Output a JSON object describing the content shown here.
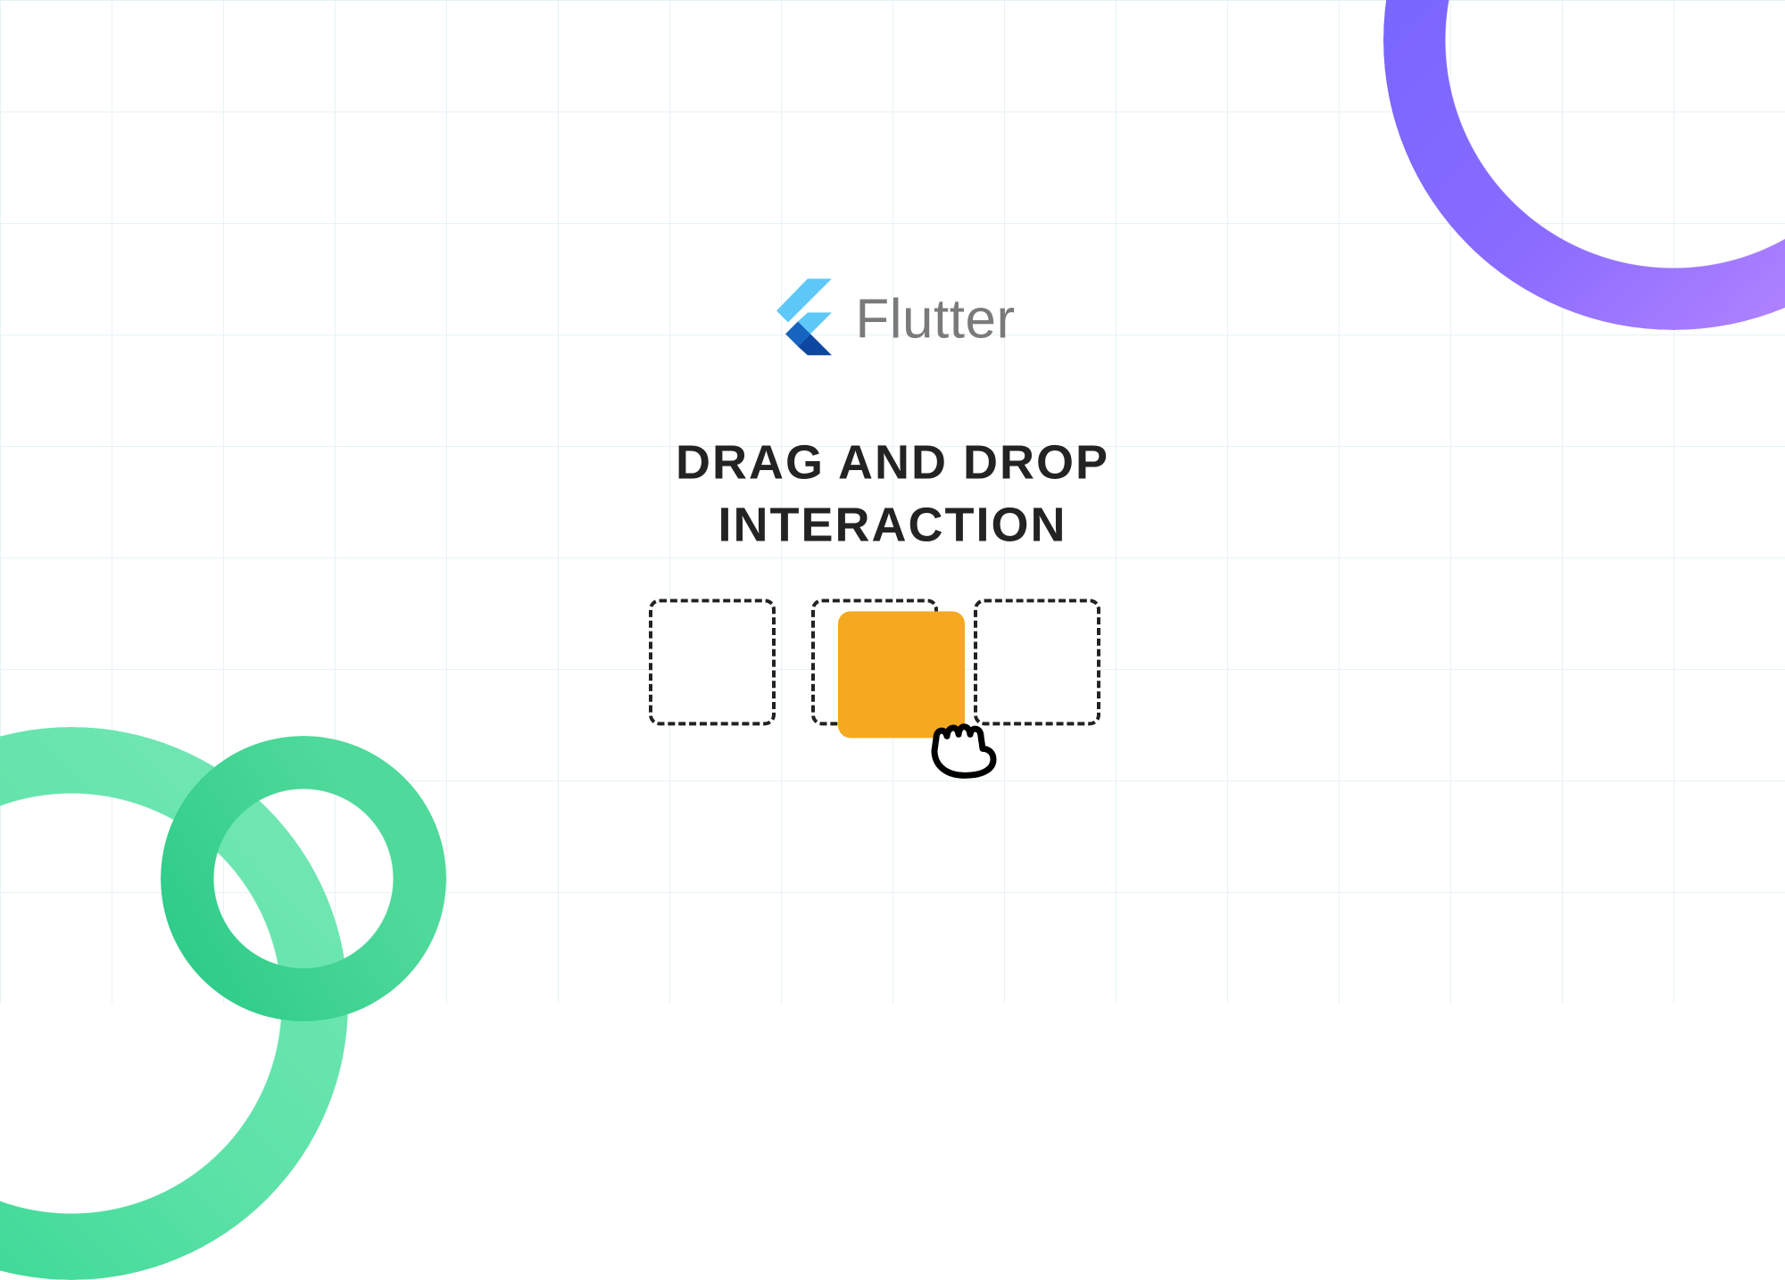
{
  "brand": {
    "name": "Flutter"
  },
  "headline": {
    "line1": "DRAG AND DROP",
    "line2": "INTERACTION"
  },
  "colors": {
    "chip": "#f5a920",
    "grid": "#e6f2f7"
  },
  "icons": {
    "flutter_logo": "flutter-logo-icon",
    "grab_cursor": "grab-cursor-icon"
  }
}
